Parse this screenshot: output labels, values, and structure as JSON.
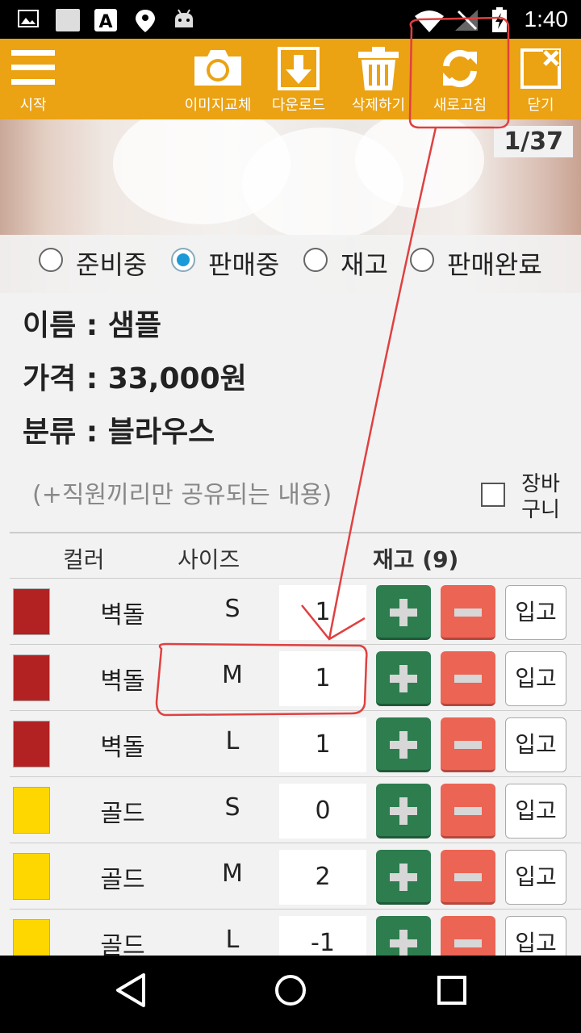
{
  "status_bar": {
    "time": "1:40"
  },
  "toolbar": {
    "menu_label": "시작",
    "change_image_label": "이미지교체",
    "download_label": "다운로드",
    "delete_label": "삭제하기",
    "refresh_label": "새로고침",
    "close_label": "닫기"
  },
  "image": {
    "counter": "1/37"
  },
  "status_options": [
    {
      "label": "준비중",
      "checked": false
    },
    {
      "label": "판매중",
      "checked": true
    },
    {
      "label": "재고",
      "checked": false
    },
    {
      "label": "판매완료",
      "checked": false
    }
  ],
  "product": {
    "name": "이름 : 샘플",
    "price": "가격 : 33,000원",
    "category": "분류 : 블라우스"
  },
  "memo_placeholder": "(+직원끼리만 공유되는 내용)",
  "cart_label": "장바구니",
  "table": {
    "headers": {
      "color": "컬러",
      "size": "사이즈",
      "stock": "재고 (9)"
    },
    "in_label": "입고",
    "rows": [
      {
        "color_name": "벽돌",
        "color_hex": "#b22222",
        "size": "S",
        "qty": "1"
      },
      {
        "color_name": "벽돌",
        "color_hex": "#b22222",
        "size": "M",
        "qty": "1"
      },
      {
        "color_name": "벽돌",
        "color_hex": "#b22222",
        "size": "L",
        "qty": "1"
      },
      {
        "color_name": "골드",
        "color_hex": "#ffd700",
        "size": "S",
        "qty": "0"
      },
      {
        "color_name": "골드",
        "color_hex": "#ffd700",
        "size": "M",
        "qty": "2"
      },
      {
        "color_name": "골드",
        "color_hex": "#ffd700",
        "size": "L",
        "qty": "-1"
      }
    ]
  },
  "colors": {
    "toolbar": "#eba213",
    "plus": "#2d7d4f",
    "minus": "#ec6454",
    "radio_selected": "#1a9ad6",
    "annotation": "#e04040"
  }
}
